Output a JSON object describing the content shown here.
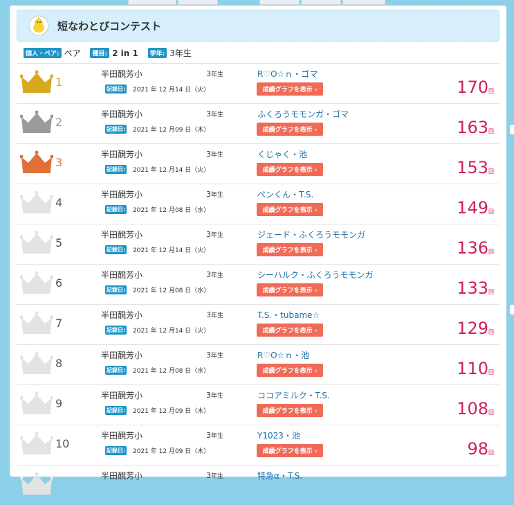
{
  "header": {
    "title": "短なわとびコンテスト",
    "icon": "chick-icon"
  },
  "filters": [
    {
      "label": "個人・ペア:",
      "value": "ペア",
      "bold": false
    },
    {
      "label": "種目:",
      "value": "2 in 1",
      "bold": true
    },
    {
      "label": "学年:",
      "value": "3年生",
      "bold": false
    }
  ],
  "labels": {
    "date_badge": "記録日:",
    "graph_button": "成績グラフを表示 ›",
    "unit": "回"
  },
  "colors": {
    "gold": "#d8a81f",
    "silver": "#9a9a9a",
    "bronze": "#e07035",
    "plain": "#e3e3e3",
    "accent": "#1e95c9",
    "score": "#d01f5a"
  },
  "rows": [
    {
      "rank": "1",
      "crown": "gold",
      "school": "半田醗芳小",
      "grade": "3",
      "grade_suffix": "年生",
      "date": "2021 年 12 月14 日（火）",
      "team": "R♡O☆ｎ・ゴマ",
      "score": "170"
    },
    {
      "rank": "2",
      "crown": "silver",
      "school": "半田醗芳小",
      "grade": "3",
      "grade_suffix": "年生",
      "date": "2021 年 12 月09 日（木）",
      "team": "ふくろうモモンガ・ゴマ",
      "score": "163"
    },
    {
      "rank": "3",
      "crown": "bronze",
      "school": "半田醗芳小",
      "grade": "3",
      "grade_suffix": "年生",
      "date": "2021 年 12 月14 日（火）",
      "team": "くじゃく・池",
      "score": "153"
    },
    {
      "rank": "4",
      "crown": "plain",
      "school": "半田醗芳小",
      "grade": "3",
      "grade_suffix": "年生",
      "date": "2021 年 12 月08 日（水）",
      "team": "ぺンくん・T.S.",
      "score": "149"
    },
    {
      "rank": "5",
      "crown": "plain",
      "school": "半田醗芳小",
      "grade": "3",
      "grade_suffix": "年生",
      "date": "2021 年 12 月14 日（火）",
      "team": "ジェード・ふくろうモモンガ",
      "score": "136"
    },
    {
      "rank": "6",
      "crown": "plain",
      "school": "半田醗芳小",
      "grade": "3",
      "grade_suffix": "年生",
      "date": "2021 年 12 月08 日（水）",
      "team": "シーハルク・ふくろうモモンガ",
      "score": "133"
    },
    {
      "rank": "7",
      "crown": "plain",
      "school": "半田醗芳小",
      "grade": "3",
      "grade_suffix": "年生",
      "date": "2021 年 12 月14 日（火）",
      "team": "T.S.・tubame☆",
      "score": "129"
    },
    {
      "rank": "8",
      "crown": "plain",
      "school": "半田醗芳小",
      "grade": "3",
      "grade_suffix": "年生",
      "date": "2021 年 12 月08 日（水）",
      "team": "R♡O☆ｎ・池",
      "score": "110"
    },
    {
      "rank": "9",
      "crown": "plain",
      "school": "半田醗芳小",
      "grade": "3",
      "grade_suffix": "年生",
      "date": "2021 年 12 月09 日（木）",
      "team": "ココアミルク・T.S.",
      "score": "108"
    },
    {
      "rank": "10",
      "crown": "plain",
      "school": "半田醗芳小",
      "grade": "3",
      "grade_suffix": "年生",
      "date": "2021 年 12 月09 日（木）",
      "team": "Y1023・池",
      "score": "98"
    },
    {
      "rank": "",
      "crown": "plain",
      "school": "半田醗芳小",
      "grade": "3",
      "grade_suffix": "年生",
      "date": "",
      "team": "特急α・T.S.",
      "score": ""
    }
  ]
}
